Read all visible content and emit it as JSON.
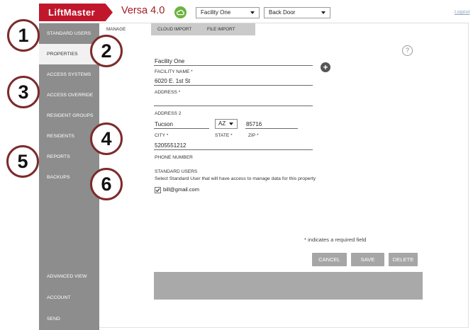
{
  "header": {
    "logo_text": "LiftMaster",
    "app_title": "Versa 4.0",
    "facility_select": {
      "value": "Facility One"
    },
    "door_select": {
      "value": "Back Door"
    },
    "logout_label": "Logout"
  },
  "sidebar": {
    "items": [
      {
        "label": "STANDARD USERS",
        "active": false
      },
      {
        "label": "PROPERTIES",
        "active": true
      },
      {
        "label": "ACCESS SYSTEMS",
        "active": false
      },
      {
        "label": "ACCESS OVERRIDE",
        "active": false
      },
      {
        "label": "RESIDENT GROUPS",
        "active": false
      },
      {
        "label": "RESIDENTS",
        "active": false
      },
      {
        "label": "REPORTS",
        "active": false
      },
      {
        "label": "BACKUPS",
        "active": false
      }
    ],
    "footer_items": [
      {
        "label": "ADVANCED VIEW"
      },
      {
        "label": "ACCOUNT"
      },
      {
        "label": "SEND"
      }
    ]
  },
  "tabs": [
    {
      "label": "MANAGE",
      "active": true
    },
    {
      "label": "CLOUD IMPORT",
      "active": false
    },
    {
      "label": "FILE IMPORT",
      "active": false
    }
  ],
  "form": {
    "facility_name": {
      "value": "Facility One",
      "label": "FACILITY NAME *"
    },
    "address": {
      "value": "6020 E. 1st St",
      "label": "ADDRESS *"
    },
    "address2": {
      "value": "",
      "label": "ADDRESS 2"
    },
    "city": {
      "value": "Tucson",
      "label": "CITY *"
    },
    "state": {
      "value": "AZ",
      "label": "STATE *"
    },
    "zip": {
      "value": "85716",
      "label": "ZIP *"
    },
    "phone": {
      "value": "5205551212",
      "label": "PHONE NUMBER"
    },
    "standard_users": {
      "heading": "STANDARD USERS",
      "hint": "Select Standard User that will have access to manage data for this property",
      "users": [
        {
          "email": "bill@gmail.com",
          "checked": true
        }
      ]
    },
    "required_note": "* indicates a required field"
  },
  "actions": {
    "cancel_label": "CANCEL",
    "save_label": "SAVE",
    "delete_label": "DELETE"
  },
  "callouts": [
    "1",
    "2",
    "3",
    "4",
    "5",
    "6"
  ],
  "icons": {
    "cloud": "cloud-icon",
    "help": "help-icon",
    "add": "add-icon",
    "dropdown": "chevron-down-icon",
    "checkbox": "checkbox-checked-icon"
  },
  "icon_glyphs": {
    "help": "?",
    "add": "+"
  },
  "colors": {
    "brand_red": "#c0172d",
    "title_red": "#a01c22",
    "sidebar_gray": "#8d8d8d",
    "active_item_bg": "#f1f1f1",
    "tab_gray": "#cacaca",
    "button_gray": "#a6a6a6",
    "panel_gray": "#a9a9a9",
    "callout_border": "#7c2b2b",
    "cloud_green": "#6db33f",
    "add_button": "#555555",
    "logout_link": "#8fa3b8"
  }
}
